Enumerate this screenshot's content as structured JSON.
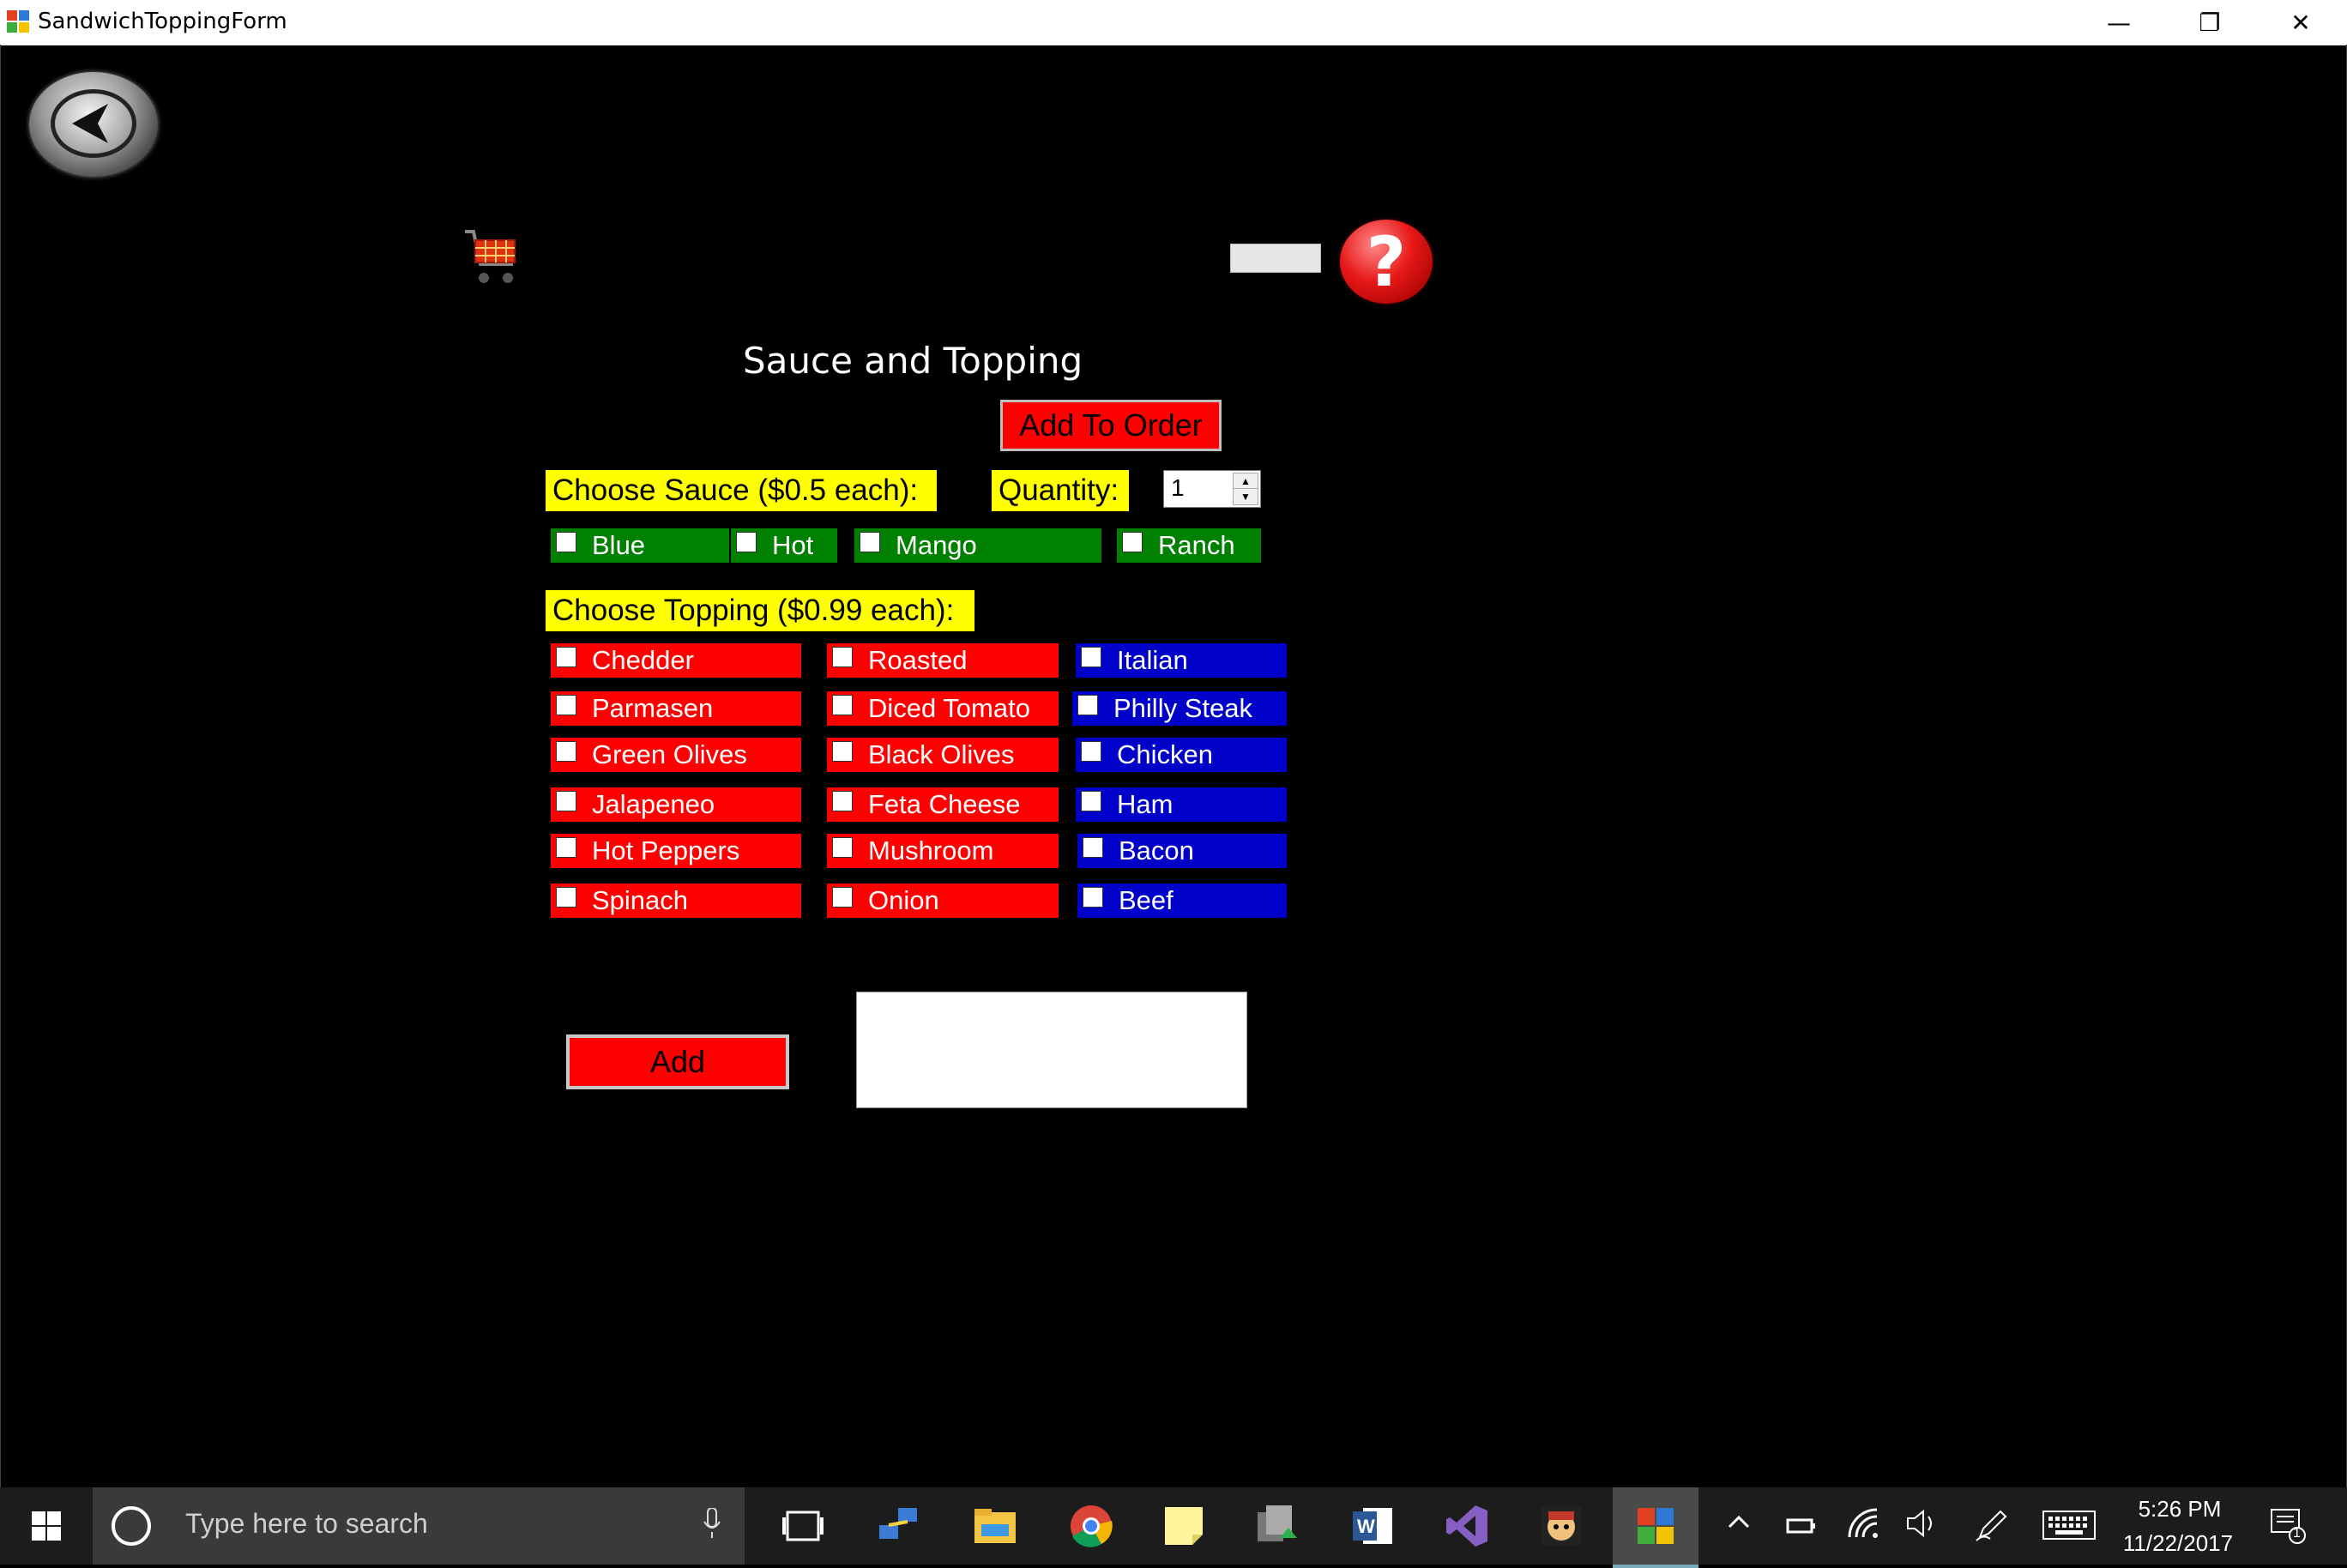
{
  "window": {
    "title": "SandwichToppingForm",
    "minimize": "—",
    "restore": "❐",
    "close": "✕"
  },
  "page": {
    "title": "Sauce and Topping",
    "add_to_order_label": "Add To Order",
    "add_label": "Add",
    "help_glyph": "?"
  },
  "sauce": {
    "label": "Choose Sauce ($0.5 each):",
    "options": [
      "Blue",
      "Hot",
      "Mango",
      "Ranch"
    ]
  },
  "quantity": {
    "label": "Quantity:",
    "value": "1",
    "up_glyph": "▲",
    "down_glyph": "▼"
  },
  "topping": {
    "label": "Choose Topping ($0.99 each):",
    "column1": [
      "Chedder",
      "Parmasen",
      "Green Olives",
      "Jalapeneo",
      "Hot Peppers",
      "Spinach"
    ],
    "column2": [
      "Roasted",
      "Diced Tomato",
      "Black Olives",
      "Feta Cheese",
      "Mushroom",
      "Onion"
    ],
    "column3": [
      "Italian",
      "Philly Steak",
      "Chicken",
      "Ham",
      "Bacon",
      "Beef"
    ]
  },
  "colors": {
    "sauce_bg": "#008000",
    "topping_veg_bg": "#ff0000",
    "topping_meat_bg": "#0000c8",
    "label_bg": "#ffff00",
    "button_bg": "#ff0000"
  },
  "taskbar": {
    "search_placeholder": "Type here to search",
    "time": "5:26 PM",
    "date": "11/22/2017",
    "notification_count": "1",
    "apps": [
      "task-view-icon",
      "network-app-icon",
      "file-explorer-icon",
      "chrome-icon",
      "sticky-notes-icon",
      "vpn-app-icon",
      "word-icon",
      "visual-studio-icon",
      "game-app-icon",
      "sandwich-form-app-icon"
    ]
  }
}
